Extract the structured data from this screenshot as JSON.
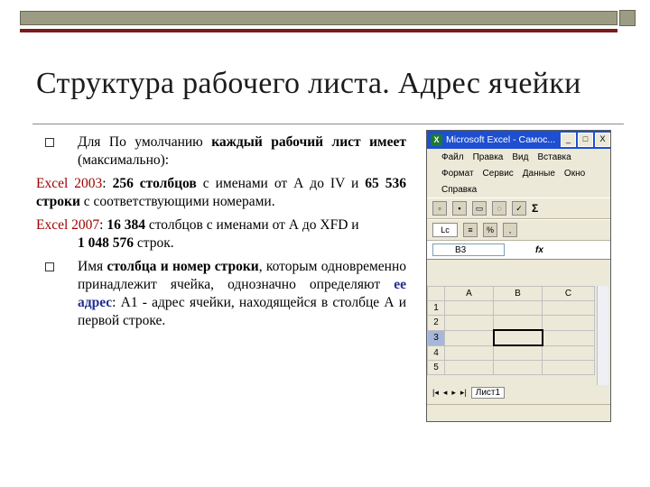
{
  "title": "Структура рабочего листа. Адрес ячейки",
  "bullets": {
    "b1_pre": "Для По умолчанию ",
    "b1_bold": "каждый рабочий лист имеет",
    "b1_post": " (максимально):",
    "excel2003_label": "Excel 2003",
    "excel2003_colon": ": ",
    "excel2003_cols": "256 столбцов",
    "excel2003_mid": " с именами от А до IV и ",
    "excel2003_rows": "65 536 строки",
    "excel2003_post": " с соответствующими номерами.",
    "excel2007_label": "Excel 2007",
    "excel2007_colon": ":  ",
    "excel2007_cols": "16 384",
    "excel2007_mid": " столбцов с именами от А до XFD и",
    "excel2007_rows": "1 048 576",
    "excel2007_post": "  строк.",
    "b2_pre": "Имя ",
    "b2_bold": "столбца и номер строки",
    "b2_mid": ", которым одновременно принадлежит ячейка, однозначно определяют ",
    "b2_blue": "ее адрес",
    "b2_post": ": А1 - адрес ячейки, находящейся в столбце А и первой строке."
  },
  "excel": {
    "window_title": "Microsoft Excel - Самос...",
    "app_icon": "X",
    "minimize": "_",
    "maximize": "□",
    "close": "X",
    "menu1": [
      "Файл",
      "Правка",
      "Вид",
      "Вставка"
    ],
    "menu2": [
      "Формат",
      "Сервис",
      "Данные",
      "Окно"
    ],
    "menu3": [
      "Справка"
    ],
    "sigma": "Σ",
    "font_box": "Lc",
    "name_box": "B3",
    "fx": "fx",
    "columns": [
      "A",
      "B",
      "C"
    ],
    "rows": [
      "1",
      "2",
      "3",
      "4",
      "5"
    ],
    "sheet_tab": "Лист1"
  }
}
